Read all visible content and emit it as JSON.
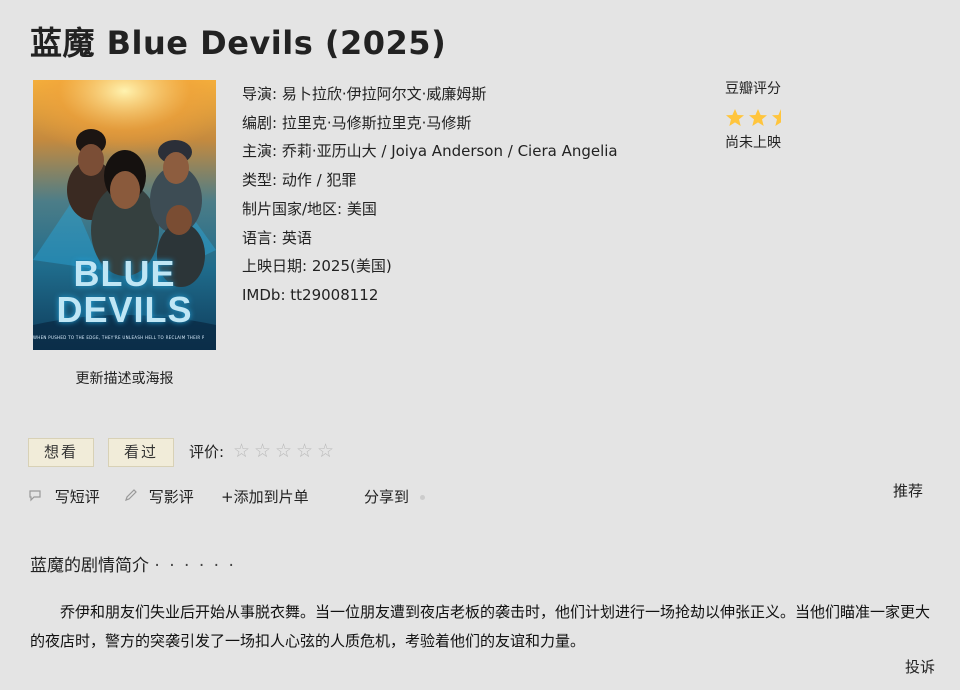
{
  "page": {
    "title": "蓝魔 Blue Devils (2025)"
  },
  "poster": {
    "word1": "BLUE",
    "word2": "DEVILS",
    "tagline": "WHEN PUSHED TO THE EDGE, THEY'RE UNLEASH HELL TO RECLAIM THEIR POWER",
    "update_link": "更新描述或海报",
    "colors": {
      "top": "#f5b23c",
      "bottom": "#0e3b5a",
      "accent": "#27a9e0"
    }
  },
  "info": {
    "director_label": "导演:",
    "director": "易卜拉欣·伊拉阿尔文·威廉姆斯",
    "writer_label": "编剧:",
    "writer": "拉里克·马修斯拉里克·马修斯",
    "cast_label": "主演:",
    "cast": "乔莉·亚历山大 / Joiya Anderson / Ciera Angelia",
    "genre_label": "类型:",
    "genre": "动作 / 犯罪",
    "country_label": "制片国家/地区:",
    "country": "美国",
    "language_label": "语言:",
    "language": "英语",
    "release_label": "上映日期:",
    "release": "2025(美国)",
    "imdb_label": "IMDb:",
    "imdb": "tt29008112"
  },
  "rating": {
    "title": "豆瓣评分",
    "status": "尚未上映",
    "stars_filled": 2.5,
    "star_color": "#ffc53d"
  },
  "user_actions": {
    "want_label": "想看",
    "seen_label": "看过",
    "rate_label": "评价:",
    "rate_stars": [
      "☆",
      "☆",
      "☆",
      "☆",
      "☆"
    ],
    "short_review_label": "写短评",
    "review_label": "写影评",
    "add_list_label": "+添加到片单",
    "share_label": "分享到",
    "recommend_label": "推荐",
    "icons": [
      "comment-icon",
      "pencil-icon",
      "plus-icon"
    ]
  },
  "synopsis": {
    "title": "蓝魔的剧情简介",
    "dots": "· · · · · ·",
    "text": "乔伊和朋友们失业后开始从事脱衣舞。当一位朋友遭到夜店老板的袭击时，他们计划进行一场抢劫以伸张正义。当他们瞄准一家更大的夜店时，警方的突袭引发了一场扣人心弦的人质危机，考验着他们的友谊和力量。",
    "report_label": "投诉"
  }
}
